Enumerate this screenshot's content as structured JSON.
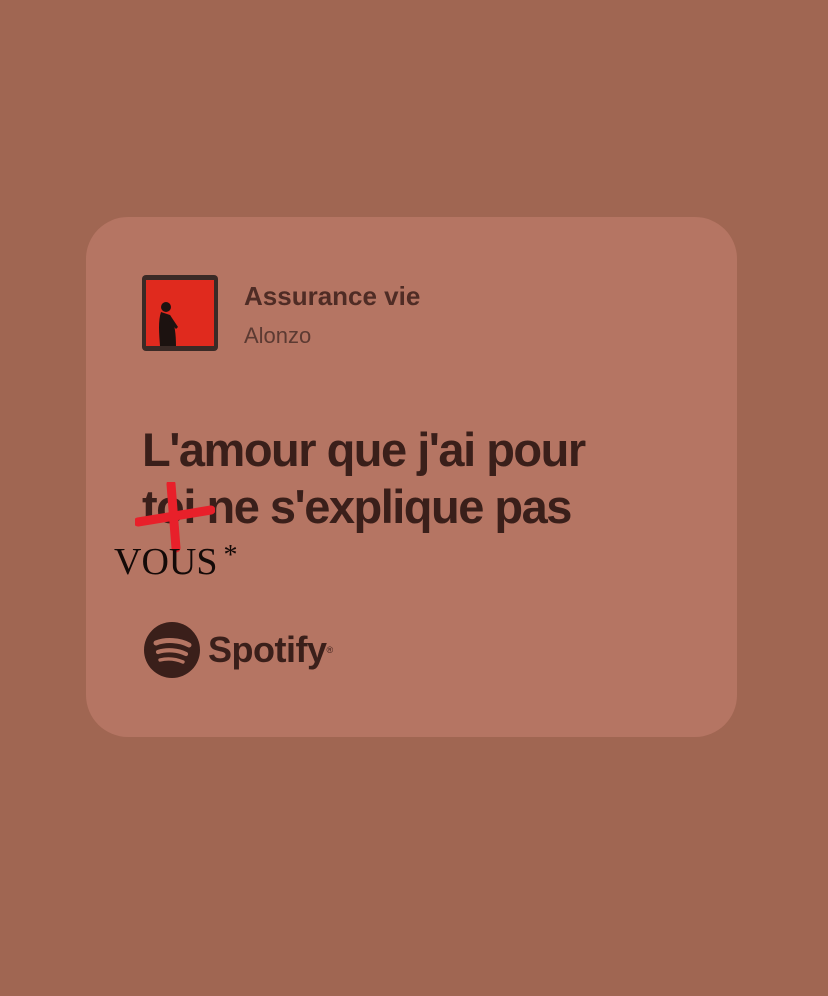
{
  "card": {
    "track_title": "Assurance vie",
    "artist": "Alonzo",
    "lyric_line_1": "L'amour que j'ai pour",
    "lyric_struck_word": "toi",
    "lyric_line_2_rest": " ne s'explique pas",
    "brand": "Spotify",
    "brand_mark": "®"
  },
  "annotation": {
    "correction": "VOUS",
    "asterisk": "*"
  },
  "colors": {
    "background": "#a06652",
    "card": "#b57563",
    "text": "#3a1f1a",
    "cross": "#e8202a"
  },
  "icons": {
    "album_cover": "album-cover-image",
    "brand_logo": "spotify-logo-icon",
    "strike": "red-cross-icon"
  }
}
